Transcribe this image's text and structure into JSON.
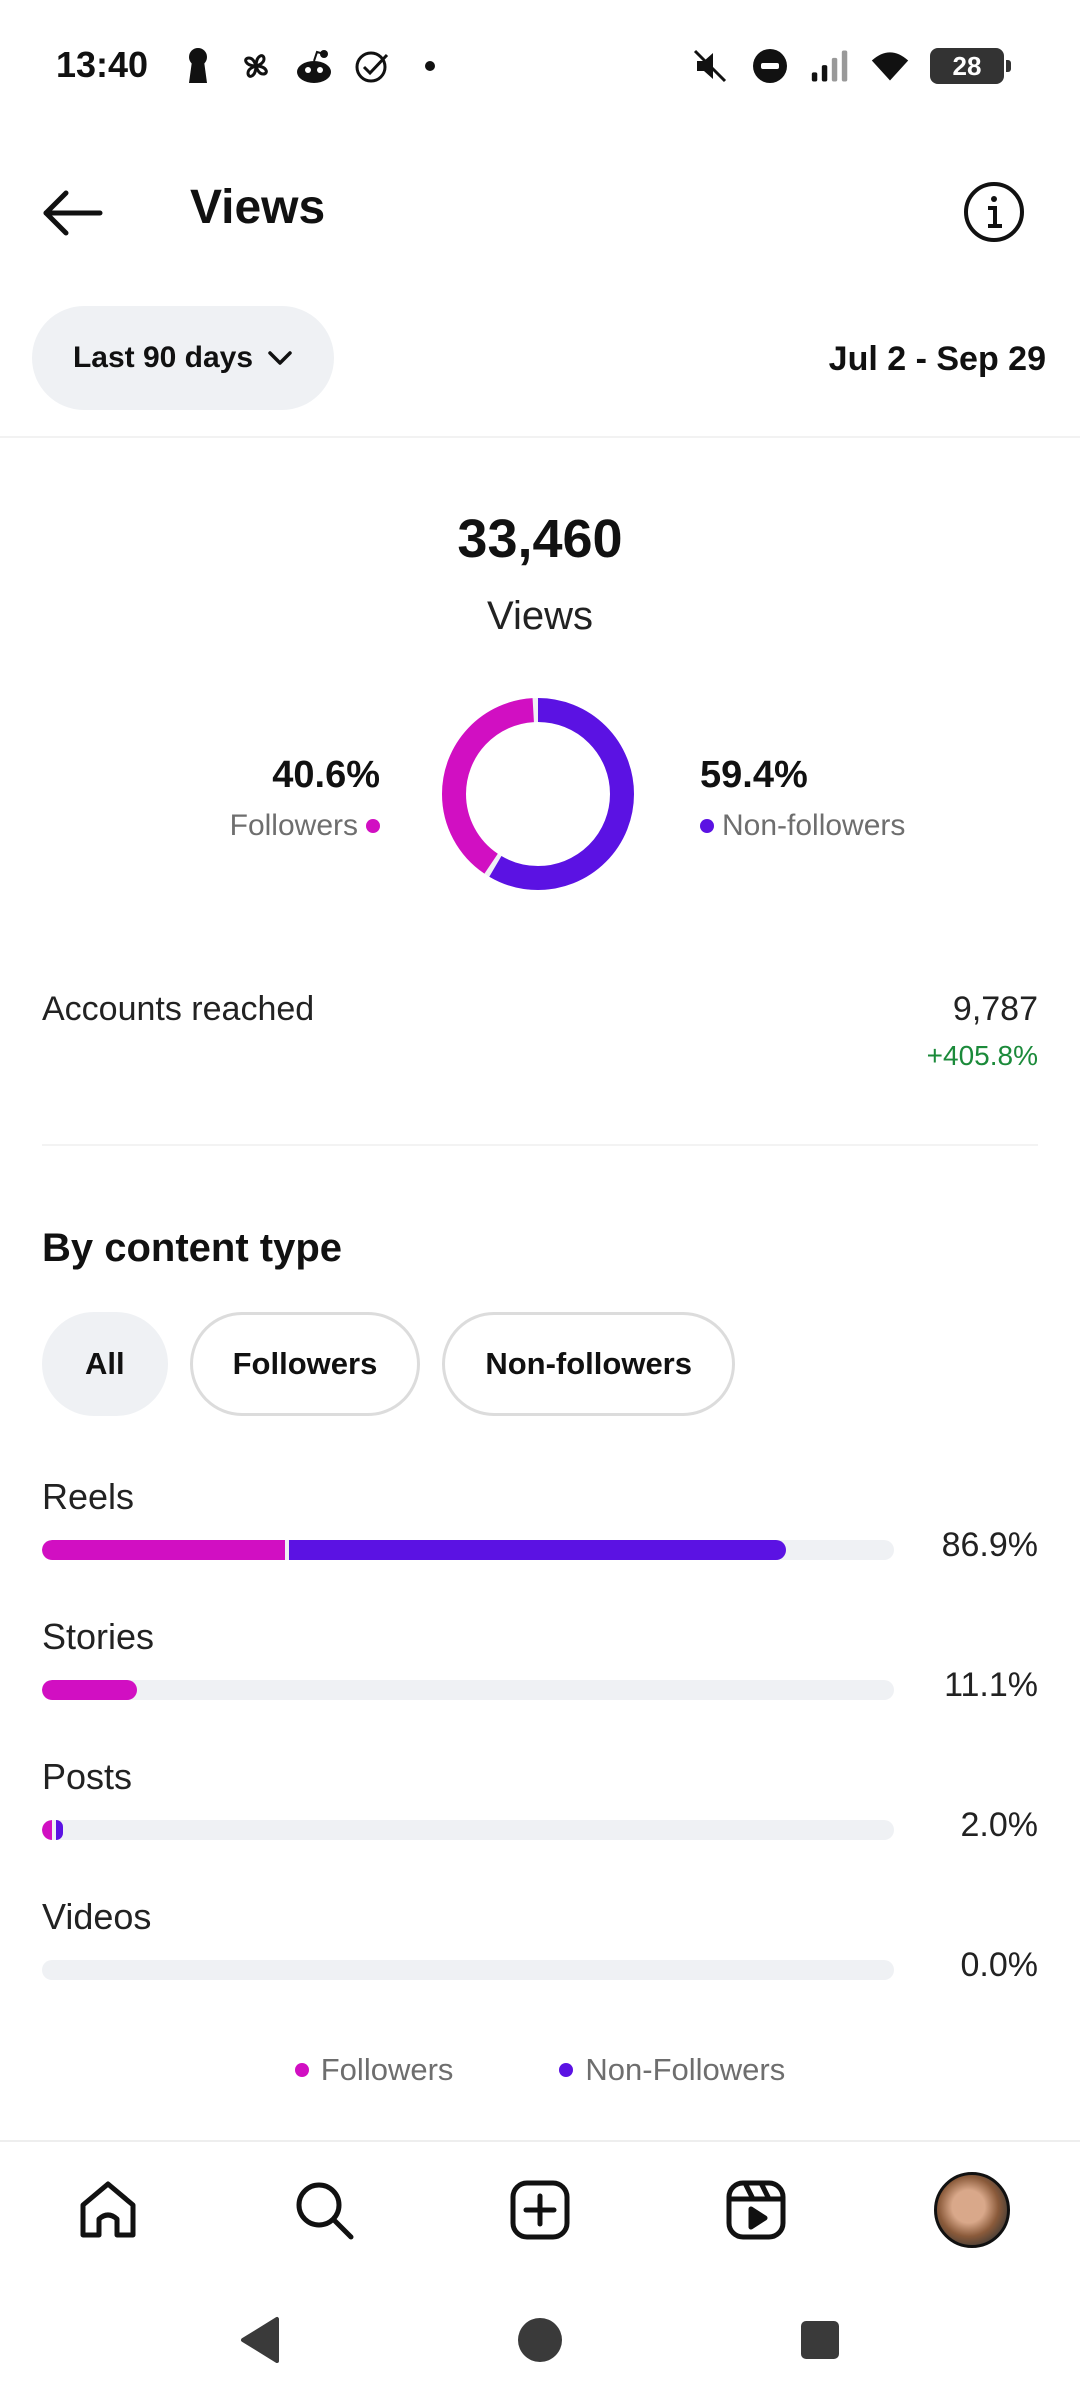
{
  "status_bar": {
    "time": "13:40",
    "battery": "28"
  },
  "header": {
    "title": "Views"
  },
  "filters": {
    "range_label": "Last 90 days",
    "date_range": "Jul 2 - Sep 29"
  },
  "summary": {
    "total": "33,460",
    "label": "Views",
    "followers_pct": "40.6%",
    "followers_label": "Followers",
    "nonfollowers_pct": "59.4%",
    "nonfollowers_label": "Non-followers",
    "followers_share": 0.406,
    "nonfollowers_share": 0.594
  },
  "accounts_reached": {
    "label": "Accounts reached",
    "value": "9,787",
    "change": "+405.8%"
  },
  "content_type": {
    "title": "By content type",
    "chips": [
      {
        "label": "All",
        "active": true
      },
      {
        "label": "Followers",
        "active": false
      },
      {
        "label": "Non-followers",
        "active": false
      }
    ],
    "rows": [
      {
        "label": "Reels",
        "pct": "86.9%",
        "followers_fraction": 0.285,
        "nonfollowers_fraction": 0.584
      },
      {
        "label": "Stories",
        "pct": "11.1%",
        "followers_fraction": 0.111,
        "nonfollowers_fraction": 0.0
      },
      {
        "label": "Posts",
        "pct": "2.0%",
        "followers_fraction": 0.012,
        "nonfollowers_fraction": 0.008
      },
      {
        "label": "Videos",
        "pct": "0.0%",
        "followers_fraction": 0.0,
        "nonfollowers_fraction": 0.0
      }
    ],
    "legend": {
      "followers": "Followers",
      "nonfollowers": "Non-Followers"
    }
  },
  "colors": {
    "followers": "#d10fc2",
    "nonfollowers": "#5b12e3",
    "positive": "#1b8a3a"
  },
  "bottom_nav": [
    "home-icon",
    "search-icon",
    "create-icon",
    "reels-icon",
    "profile-avatar"
  ],
  "system_nav": [
    "back-triangle-icon",
    "home-circle-icon",
    "recents-square-icon"
  ]
}
